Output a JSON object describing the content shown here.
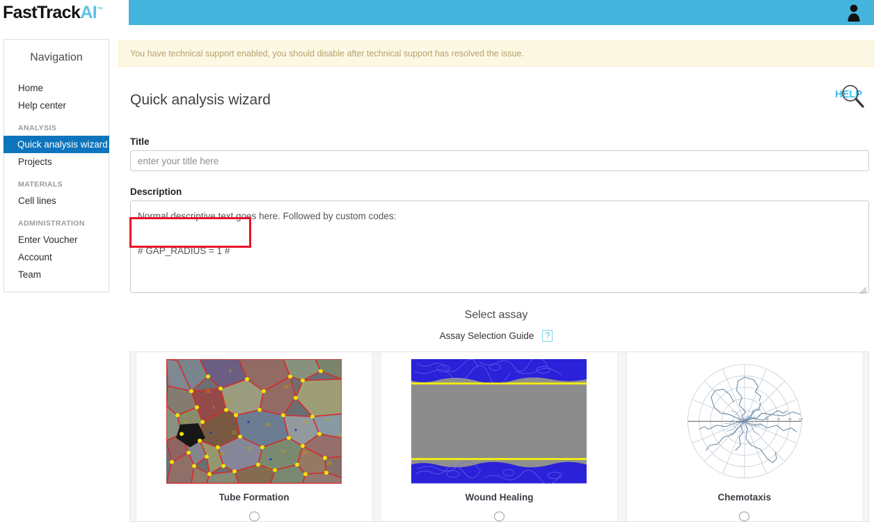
{
  "header": {
    "logo_main": "FastTrack",
    "logo_accent": "AI",
    "logo_tm": "™",
    "avatar_icon": "user-avatar-icon",
    "bar_color": "#45b4dc"
  },
  "sidebar": {
    "title": "Navigation",
    "items": [
      {
        "label": "Home",
        "type": "link",
        "active": false
      },
      {
        "label": "Help center",
        "type": "link",
        "active": false
      },
      {
        "label": "ANALYSIS",
        "type": "section"
      },
      {
        "label": "Quick analysis wizard",
        "type": "link",
        "active": true
      },
      {
        "label": "Projects",
        "type": "link",
        "active": false
      },
      {
        "label": "MATERIALS",
        "type": "section"
      },
      {
        "label": "Cell lines",
        "type": "link",
        "active": false
      },
      {
        "label": "ADMINISTRATION",
        "type": "section"
      },
      {
        "label": "Enter Voucher",
        "type": "link",
        "active": false
      },
      {
        "label": "Account",
        "type": "link",
        "active": false
      },
      {
        "label": "Team",
        "type": "link",
        "active": false
      }
    ],
    "active_color": "#0d74bd"
  },
  "banner": {
    "text": "You have technical support enabled, you should disable after technical support has resolved the issue.",
    "background": "#fcf8e3",
    "text_color": "#b5a36d"
  },
  "main": {
    "page_title": "Quick analysis wizard",
    "help_badge": {
      "label": "HELP",
      "icon": "magnifier-icon",
      "color": "#3ec0ec"
    },
    "title_field": {
      "label": "Title",
      "placeholder": "enter your title here",
      "value": ""
    },
    "description_field": {
      "label": "Description",
      "value": "Normal descriptive text goes here. Followed by custom codes:\n\n# GAP_RADIUS = 1 #",
      "line1": "Normal descriptive text goes here. Followed by custom codes:",
      "line2": "# GAP_RADIUS = 1 #"
    },
    "annotation": {
      "shape": "rectangle",
      "color": "#e8102a",
      "targets": "# GAP_RADIUS = 1 #"
    },
    "assay_section": {
      "heading": "Select assay",
      "guide_label": "Assay Selection Guide",
      "guide_button": "?",
      "guide_button_color": "#41bde8"
    },
    "assay_cards": [
      {
        "label": "Tube Formation",
        "thumb_kind": "tube-formation-segmentation",
        "selected": false
      },
      {
        "label": "Wound Healing",
        "thumb_kind": "wound-healing-scratch",
        "selected": false
      },
      {
        "label": "Chemotaxis",
        "thumb_kind": "chemotaxis-rose-plot",
        "selected": false
      }
    ]
  }
}
